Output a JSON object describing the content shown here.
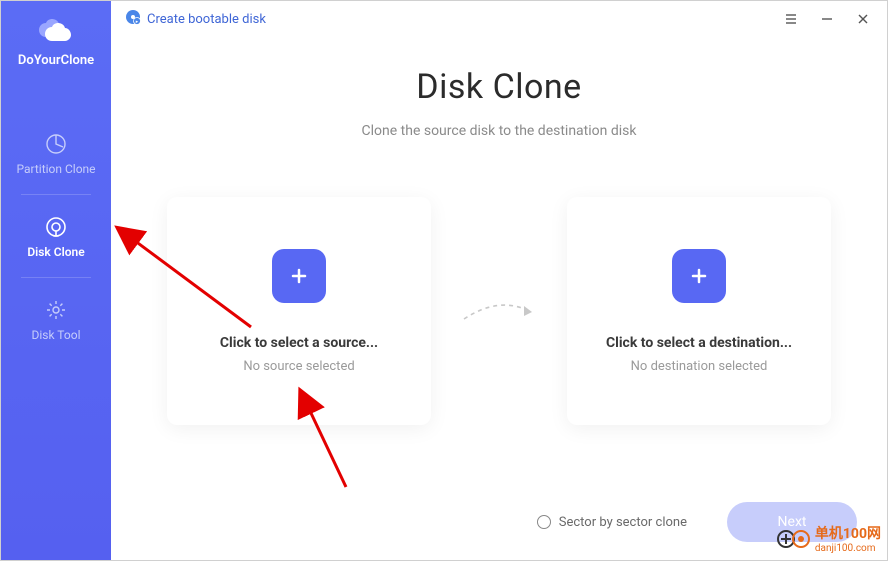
{
  "app": {
    "name": "DoYourClone",
    "boot_link": "Create bootable disk",
    "nav": [
      {
        "id": "partition-clone",
        "label": "Partition Clone"
      },
      {
        "id": "disk-clone",
        "label": "Disk Clone"
      },
      {
        "id": "disk-tool",
        "label": "Disk Tool"
      }
    ],
    "active_nav": "disk-clone"
  },
  "page": {
    "title": "Disk Clone",
    "subtitle": "Clone the source disk to the destination disk",
    "source_card": {
      "title": "Click to select a source...",
      "sub": "No source selected"
    },
    "dest_card": {
      "title": "Click to select a destination...",
      "sub": "No destination selected"
    },
    "sector_label": "Sector by sector clone",
    "next_label": "Next"
  },
  "watermark": {
    "cn": "单机100网",
    "url": "danji100.com"
  }
}
